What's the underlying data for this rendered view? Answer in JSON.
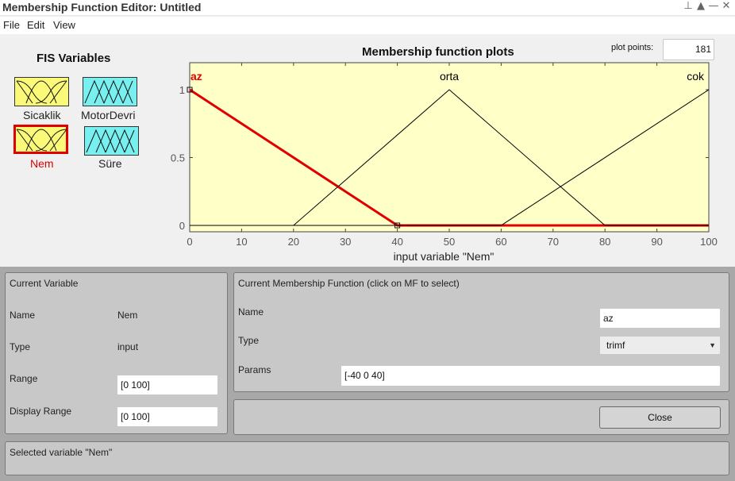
{
  "window": {
    "title": "Membership Function Editor: Untitled"
  },
  "menu": [
    "File",
    "Edit",
    "View"
  ],
  "fis_panel": {
    "title": "FIS Variables",
    "inputs": [
      {
        "name": "Sicaklik"
      },
      {
        "name": "Nem",
        "selected": true
      }
    ],
    "outputs": [
      {
        "name": "MotorDevri"
      },
      {
        "name": "Süre"
      }
    ]
  },
  "plot": {
    "title": "Membership function plots",
    "plot_points_label": "plot points:",
    "plot_points": "181",
    "xlabel": "input variable \"Nem\"",
    "xticks": [
      "0",
      "10",
      "20",
      "30",
      "40",
      "50",
      "60",
      "70",
      "80",
      "90",
      "100"
    ],
    "yticks": [
      "0",
      "0.5",
      "1"
    ],
    "colors": {
      "background": "#ffffc8",
      "selected": "#e00000",
      "normal": "#000000"
    }
  },
  "chart_data": {
    "type": "line",
    "xlabel": "input variable \"Nem\"",
    "xlim": [
      0,
      100
    ],
    "ylim": [
      0,
      1
    ],
    "series": [
      {
        "name": "az",
        "mf": "trimf",
        "params": [
          -40,
          0,
          40
        ],
        "selected": true
      },
      {
        "name": "orta",
        "mf": "trimf",
        "params": [
          20,
          50,
          80
        ]
      },
      {
        "name": "cok",
        "mf": "trimf",
        "params": [
          60,
          100,
          140
        ]
      }
    ]
  },
  "current_variable": {
    "title": "Current Variable",
    "name_label": "Name",
    "name": "Nem",
    "type_label": "Type",
    "type": "input",
    "range_label": "Range",
    "range": "[0 100]",
    "display_range_label": "Display Range",
    "display_range": "[0 100]"
  },
  "current_mf": {
    "title": "Current Membership Function (click on MF to select)",
    "name_label": "Name",
    "name": "az",
    "type_label": "Type",
    "type": "trimf",
    "params_label": "Params",
    "params": "[-40 0 40]"
  },
  "close_label": "Close",
  "status": "Selected variable \"Nem\""
}
